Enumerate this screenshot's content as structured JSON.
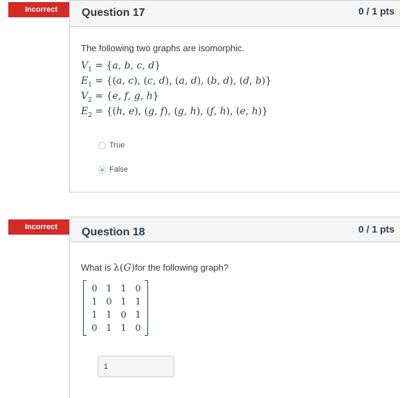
{
  "q17": {
    "badge": "Incorrect",
    "title": "Question 17",
    "points": "0 / 1 pts",
    "prompt": "The following two graphs are isomorphic.",
    "answers": [
      {
        "label": "True",
        "selected": false
      },
      {
        "label": "False",
        "selected": true
      }
    ]
  },
  "q18": {
    "badge": "Incorrect",
    "title": "Question 18",
    "points": "0 / 1 pts",
    "prompt_before": "What is ",
    "prompt_after": "for the following graph?",
    "matrix": [
      [
        "0",
        "1",
        "1",
        "0"
      ],
      [
        "1",
        "0",
        "1",
        "1"
      ],
      [
        "1",
        "1",
        "0",
        "1"
      ],
      [
        "0",
        "1",
        "1",
        "0"
      ]
    ],
    "answer_value": "1"
  }
}
